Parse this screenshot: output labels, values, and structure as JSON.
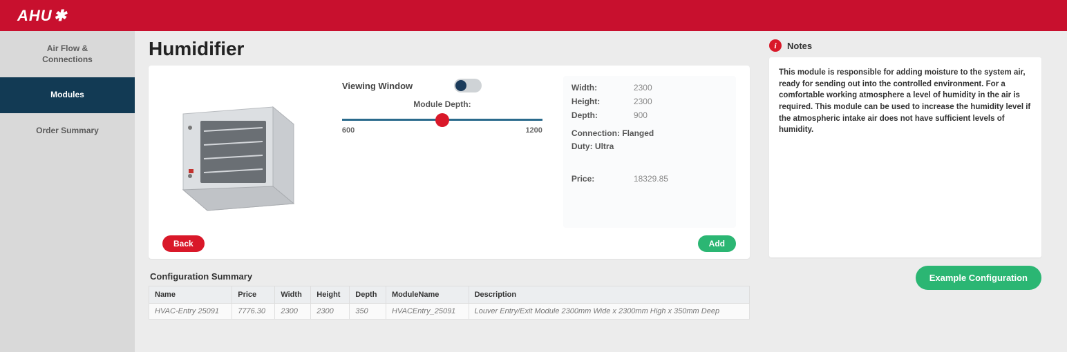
{
  "brand": "AHU",
  "sidebar": {
    "items": [
      {
        "label": "Air Flow &\nConnections"
      },
      {
        "label": "Modules"
      },
      {
        "label": "Order Summary"
      }
    ],
    "active_index": 1
  },
  "page": {
    "title": "Humidifier"
  },
  "controls": {
    "viewing_window_label": "Viewing Window",
    "viewing_window_on": false,
    "depth_label": "Module Depth:",
    "slider_min": "600",
    "slider_max": "1200"
  },
  "specs": {
    "width_k": "Width:",
    "width_v": "2300",
    "height_k": "Height:",
    "height_v": "2300",
    "depth_k": "Depth:",
    "depth_v": "900",
    "connection": "Connection: Flanged",
    "duty": "Duty: Ultra",
    "price_k": "Price:",
    "price_v": "18329.85"
  },
  "buttons": {
    "back": "Back",
    "add": "Add",
    "example": "Example Configuration"
  },
  "summary": {
    "title": "Configuration Summary",
    "headers": [
      "Name",
      "Price",
      "Width",
      "Height",
      "Depth",
      "ModuleName",
      "Description"
    ],
    "rows": [
      {
        "name": "HVAC-Entry 25091",
        "price": "7776.30",
        "width": "2300",
        "height": "2300",
        "depth": "350",
        "module": "HVACEntry_25091",
        "desc": "Louver Entry/Exit Module 2300mm Wide x 2300mm High x 350mm Deep"
      }
    ]
  },
  "notes": {
    "title": "Notes",
    "body": "This module is responsible for adding moisture to the system air, ready for sending out into the controlled environment. For a comfortable working atmosphere a level of humidity in the air is required. This module can be used to increase the humidity level if the atmospheric intake air does not have sufficient levels of humidity."
  }
}
